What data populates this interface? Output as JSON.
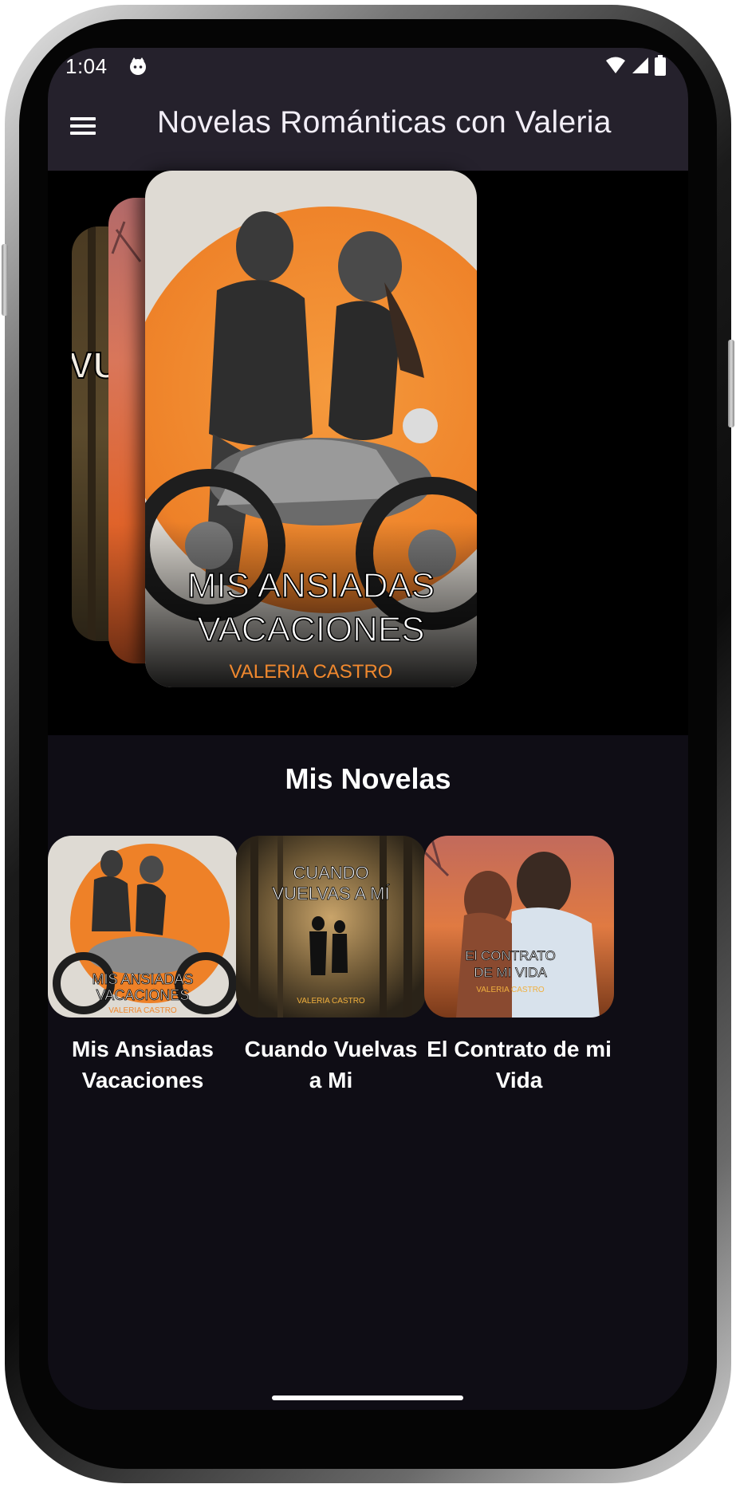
{
  "status_bar": {
    "time": "1:04"
  },
  "app_bar": {
    "title": "Novelas Románticas con Valeria"
  },
  "carousel": {
    "back_card_text": "VU",
    "front_card": {
      "title_line1": "MIS ANSIADAS",
      "title_line2": "VACACIONES",
      "author": "VALERIA CASTRO"
    }
  },
  "section": {
    "title": "Mis Novelas"
  },
  "novels": [
    {
      "title": "Mis Ansiadas Vacaciones",
      "cover_line1": "MIS ANSIADAS",
      "cover_line2": "VACACIONES",
      "cover_author": "VALERIA CASTRO"
    },
    {
      "title": "Cuando Vuelvas a Mi",
      "cover_line1": "CUANDO",
      "cover_line2": "VUELVAS A MÍ",
      "cover_author": "VALERIA CASTRO"
    },
    {
      "title": "El Contrato de mi Vida",
      "cover_line1": "El CONTRATO",
      "cover_line2": "DE MI VIDA",
      "cover_author": "VALERIA CASTRO"
    }
  ],
  "colors": {
    "app_bar": "#25212c",
    "section_bg": "#0f0d15",
    "accent_orange": "#f0882e"
  }
}
